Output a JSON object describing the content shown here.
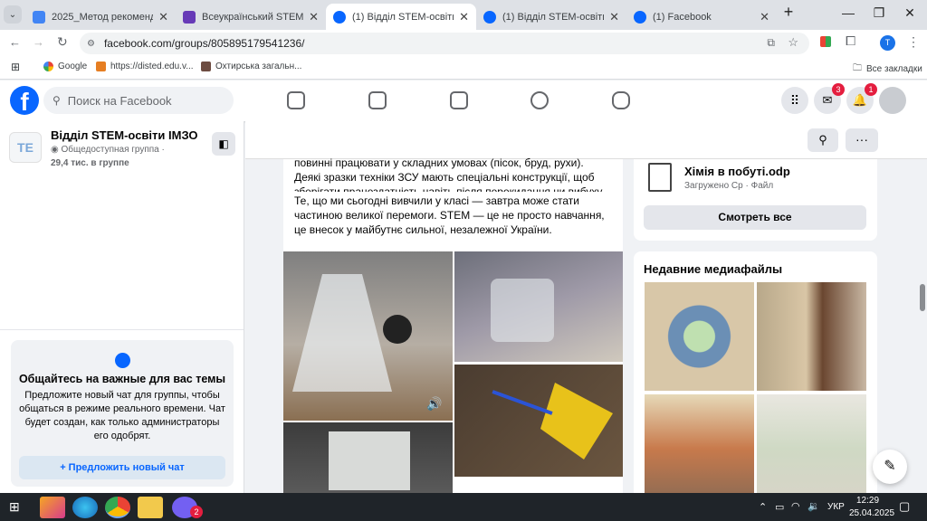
{
  "tabs": [
    {
      "title": "2025_Метод рекомендації_",
      "active": false,
      "color": "#4285f4"
    },
    {
      "title": "Всеукраїнський STEM-тижд",
      "active": false,
      "color": "#673ab7"
    },
    {
      "title": "(1) Відділ STEM-освіти ІМЗО",
      "active": true,
      "color": "#0866ff"
    },
    {
      "title": "(1) Відділ STEM-освіти ІМЗО",
      "active": false,
      "color": "#0866ff"
    },
    {
      "title": "(1) Facebook",
      "active": false,
      "color": "#0866ff"
    }
  ],
  "browser": {
    "url": "facebook.com/groups/805895179541236/",
    "bookmarks": [
      "Google",
      "https://disted.edu.v...",
      "Охтирська загальн..."
    ],
    "all_bookmarks": "Все закладки",
    "profile_letter": "T"
  },
  "fb": {
    "logo": "f",
    "search_placeholder": "Поиск на Facebook",
    "messenger_badge": "3",
    "notif_badge": "1"
  },
  "group": {
    "logo_text": "TE",
    "name": "Відділ STEM-освіти ІМЗО",
    "type": "Общедоступная группа ·",
    "members": "29,4 тис. в группе"
  },
  "chat": {
    "title": "Общайтесь на важные для вас темы",
    "desc": "Предложите новый чат для группы, чтобы общаться в режиме реального времени. Чат будет создан, как только администраторы его одобрят.",
    "button": "Предложить новый чат"
  },
  "post": {
    "p1": "повинні працювати у складних умовах (пісок, бруд, рухи). Деякі зразки техніки ЗСУ мають спеціальні конструкції, щоб зберігати працездатність навіть після перекидання чи вибуху.",
    "p2": "Те, що ми сьогодні вивчили у класі — завтра може стати частиною великої перемоги. STEM — це не просто навчання, це внесок у майбутнє сильної, незалежної України."
  },
  "files": {
    "filename": "Хімія в побуті.odp",
    "meta": "Загружено Ср · Файл",
    "see_all": "Смотреть все"
  },
  "media": {
    "title": "Недавние медиафайлы"
  },
  "taskbar": {
    "lang": "УКР",
    "time": "12:29",
    "date": "25.04.2025",
    "viber_badge": "2"
  }
}
